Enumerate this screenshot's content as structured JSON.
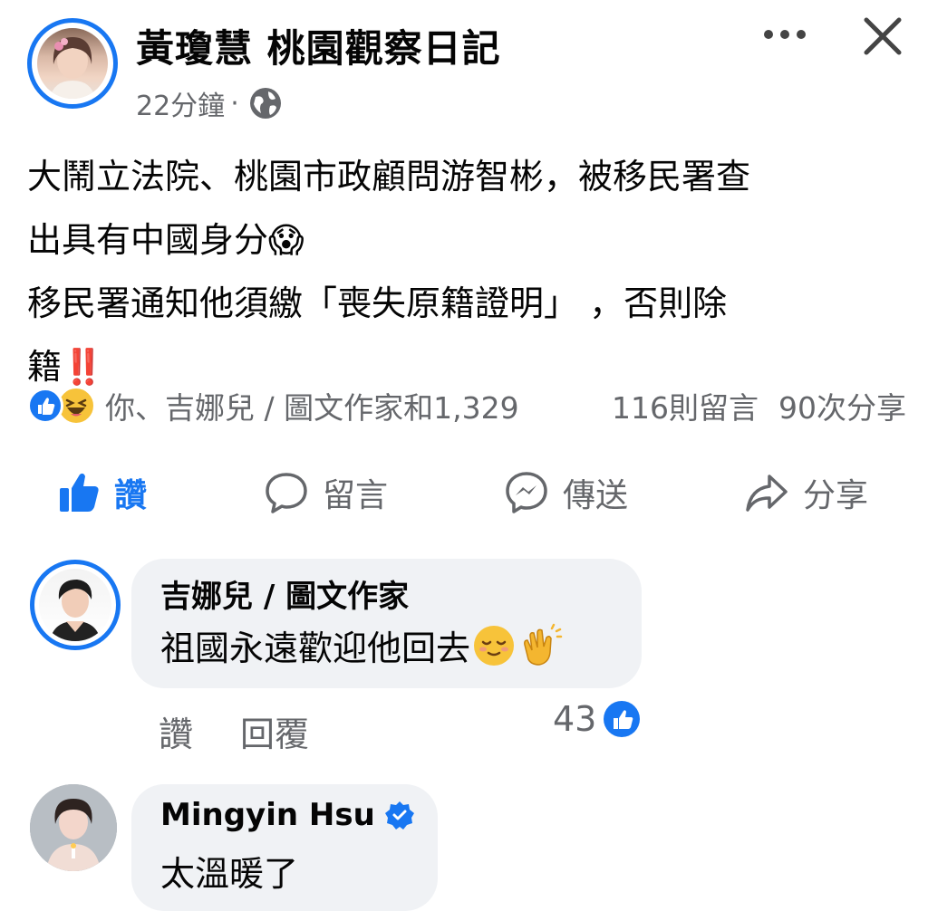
{
  "header": {
    "page_name": "黃瓊慧 桃園觀察日記",
    "time": "22分鐘",
    "separator": "·",
    "privacy_icon": "globe-icon",
    "more_icon": "more-horizontal-icon",
    "close_icon": "close-icon"
  },
  "post": {
    "text": "大鬧立法院、桃園市政顧問游智彬，被移民署查\n出具有中國身分😱\n移民署通知他須繳「喪失原籍證明」 ，否則除\n籍‼️"
  },
  "reactions": {
    "icons": [
      "like-icon",
      "haha-icon"
    ],
    "names": "你、吉娜兒 / 圖文作家和1,329",
    "comments": "116則留言",
    "shares": "90次分享"
  },
  "actions": {
    "like": "讚",
    "comment": "留言",
    "send": "傳送",
    "share": "分享"
  },
  "comments": [
    {
      "author": "吉娜兒 / 圖文作家",
      "text": "祖國永遠歡迎他回去",
      "emojis": [
        "relieved-face-icon",
        "clapping-hands-icon"
      ],
      "like_label": "讚",
      "reply_label": "回覆",
      "like_count": "43"
    },
    {
      "author": "Mingyin Hsu",
      "verified": true,
      "text": "太溫暖了"
    }
  ],
  "colors": {
    "accent": "#1877f2",
    "secondary_text": "#65676b",
    "bubble": "#f0f2f5"
  }
}
